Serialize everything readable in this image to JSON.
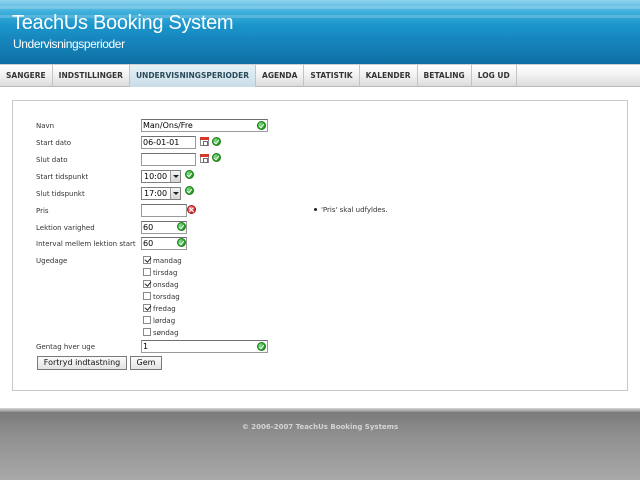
{
  "header": {
    "title": "TeachUs Booking System",
    "subtitle": "Undervisningsperioder"
  },
  "nav": {
    "items": [
      {
        "label": "SANGERE"
      },
      {
        "label": "INDSTILLINGER"
      },
      {
        "label": "UNDERVISNINGSPERIODER"
      },
      {
        "label": "AGENDA"
      },
      {
        "label": "STATISTIK"
      },
      {
        "label": "KALENDER"
      },
      {
        "label": "BETALING"
      },
      {
        "label": "LOG UD"
      }
    ],
    "active": "UNDERVISNINGSPERIODER"
  },
  "form": {
    "name": {
      "label": "Navn",
      "value": "Man/Ons/Fre",
      "status": "ok"
    },
    "start_date": {
      "label": "Start dato",
      "value": "06-01-01",
      "status": "ok"
    },
    "end_date": {
      "label": "Slut dato",
      "value": "",
      "status": "ok"
    },
    "start_time": {
      "label": "Start tidspunkt",
      "value": "10:00",
      "status": "ok"
    },
    "end_time": {
      "label": "Slut tidspunkt",
      "value": "17:00",
      "status": "ok"
    },
    "price": {
      "label": "Pris",
      "value": "",
      "status": "error"
    },
    "lesson_duration": {
      "label": "Lektion varighed",
      "value": "60",
      "status": "ok"
    },
    "lesson_interval": {
      "label": "Interval mellem lektion start",
      "value": "60",
      "status": "ok"
    },
    "weekdays": {
      "label": "Ugedage",
      "days": [
        {
          "label": "mandag",
          "checked": true
        },
        {
          "label": "tirsdag",
          "checked": false
        },
        {
          "label": "onsdag",
          "checked": true
        },
        {
          "label": "torsdag",
          "checked": false
        },
        {
          "label": "fredag",
          "checked": true
        },
        {
          "label": "lørdag",
          "checked": false
        },
        {
          "label": "søndag",
          "checked": false
        }
      ]
    },
    "repeat_weeks": {
      "label": "Gentag hver uge",
      "value": "1",
      "status": "ok"
    },
    "error_message": "'Pris' skal udfyldes.",
    "buttons": {
      "reset": "Fortryd indtastning",
      "save": "Gem"
    }
  },
  "footer": {
    "copyright": "© 2006-2007 TeachUs Booking Systems"
  },
  "colors": {
    "header_blue": "#1586bd",
    "ok_green": "#2fae2f",
    "error_red": "#e04040",
    "footer_gray": "#8d8d8d"
  }
}
